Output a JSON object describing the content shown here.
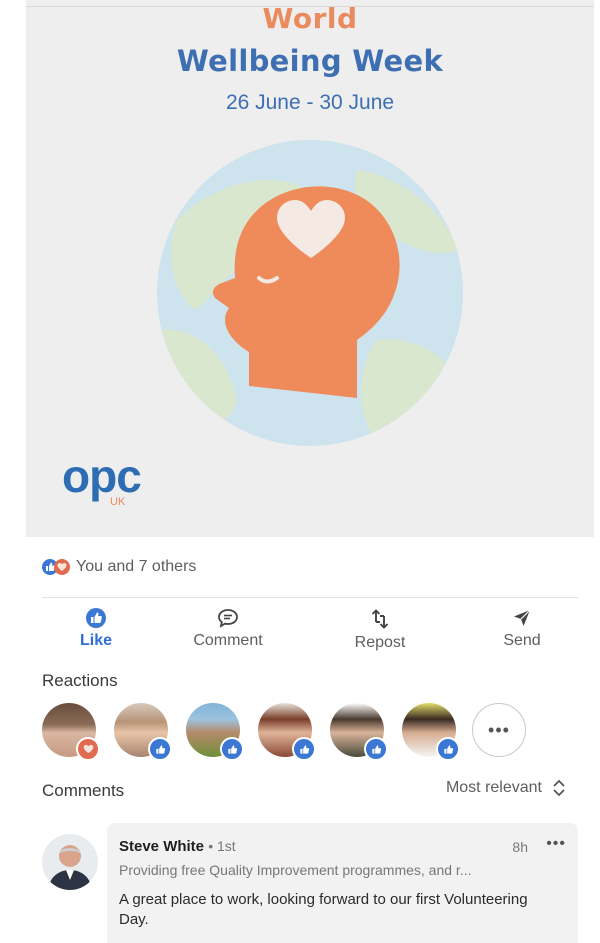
{
  "post": {
    "title_line1": "World",
    "title_line2": "Wellbeing Week",
    "dates": "26 June - 30 June",
    "logo_text": "opc",
    "logo_sub": "UK",
    "colors": {
      "orange": "#ea8b5e",
      "blue": "#3d6fb2",
      "background": "#eeeeee"
    }
  },
  "reaction_summary": {
    "text": "You and 7 others",
    "icons": [
      "like-icon",
      "heart-icon"
    ]
  },
  "actions": {
    "like": {
      "label": "Like",
      "icon": "thumbs-up-icon"
    },
    "comment": {
      "label": "Comment",
      "icon": "comment-icon"
    },
    "repost": {
      "label": "Repost",
      "icon": "repost-icon"
    },
    "send": {
      "label": "Send",
      "icon": "send-icon"
    }
  },
  "reactions": {
    "heading": "Reactions",
    "people": [
      {
        "badge": "love"
      },
      {
        "badge": "like"
      },
      {
        "badge": "like"
      },
      {
        "badge": "like"
      },
      {
        "badge": "like"
      },
      {
        "badge": "like"
      }
    ],
    "more_label": "•••"
  },
  "comments": {
    "heading": "Comments",
    "sort_label": "Most relevant",
    "items": [
      {
        "author": "Steve White",
        "degree": "• 1st",
        "time": "8h",
        "more": "•••",
        "headline": "Providing free Quality Improvement programmes, and r...",
        "text": "A great place to work, looking forward to our first Volunteering Day."
      }
    ]
  }
}
